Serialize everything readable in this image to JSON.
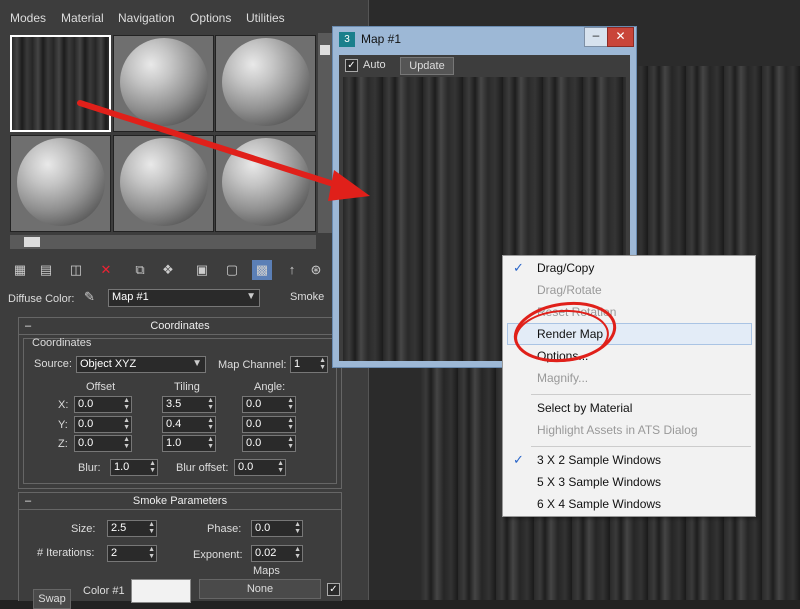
{
  "menubar": {
    "items": [
      {
        "label": "Modes"
      },
      {
        "label": "Material"
      },
      {
        "label": "Navigation"
      },
      {
        "label": "Options"
      },
      {
        "label": "Utilities"
      }
    ]
  },
  "material": {
    "diffuse_label": "Diffuse Color:",
    "map_name": "Map #1",
    "map_type": "Smoke"
  },
  "coordinates": {
    "title": "Coordinates",
    "group_label": "Coordinates",
    "source_label": "Source:",
    "source_value": "Object XYZ",
    "map_channel_label": "Map Channel:",
    "map_channel_value": "1",
    "offset_label": "Offset",
    "tiling_label": "Tiling",
    "angle_label": "Angle:",
    "rows": [
      {
        "axis": "X:",
        "offset": "0.0",
        "tiling": "3.5",
        "angle": "0.0"
      },
      {
        "axis": "Y:",
        "offset": "0.0",
        "tiling": "0.4",
        "angle": "0.0"
      },
      {
        "axis": "Z:",
        "offset": "0.0",
        "tiling": "1.0",
        "angle": "0.0"
      }
    ],
    "blur_label": "Blur:",
    "blur_value": "1.0",
    "blur_offset_label": "Blur offset:",
    "blur_offset_value": "0.0"
  },
  "smoke": {
    "title": "Smoke Parameters",
    "size_label": "Size:",
    "size_value": "2.5",
    "phase_label": "Phase:",
    "phase_value": "0.0",
    "iterations_label": "# Iterations:",
    "iterations_value": "2",
    "exponent_label": "Exponent:",
    "exponent_value": "0.02",
    "maps_label": "Maps",
    "swap_label": "Swap",
    "color1_label": "Color #1",
    "none_label": "None"
  },
  "map_window": {
    "title": "Map #1",
    "auto_label": "Auto",
    "update_label": "Update",
    "minimize": "–",
    "close": "✕"
  },
  "context_menu": {
    "items": [
      {
        "label": "Drag/Copy",
        "checked": true,
        "disabled": false
      },
      {
        "label": "Drag/Rotate",
        "checked": false,
        "disabled": true
      },
      {
        "label": "Reset Rotation",
        "checked": false,
        "disabled": true
      },
      {
        "label": "Render Map",
        "checked": false,
        "disabled": false
      },
      {
        "label": "Options...",
        "checked": false,
        "disabled": false
      },
      {
        "label": "Magnify...",
        "checked": false,
        "disabled": true
      },
      {
        "label": "Select by Material",
        "checked": false,
        "disabled": false
      },
      {
        "label": "Highlight Assets in ATS Dialog",
        "checked": false,
        "disabled": true
      },
      {
        "label": "3 X 2 Sample Windows",
        "checked": true,
        "disabled": false
      },
      {
        "label": "5 X 3 Sample Windows",
        "checked": false,
        "disabled": false
      },
      {
        "label": "6 X 4 Sample Windows",
        "checked": false,
        "disabled": false
      }
    ],
    "check_glyph": "✓"
  },
  "colors": {
    "accent": "#2a66c9",
    "annotation": "#e0201a"
  }
}
